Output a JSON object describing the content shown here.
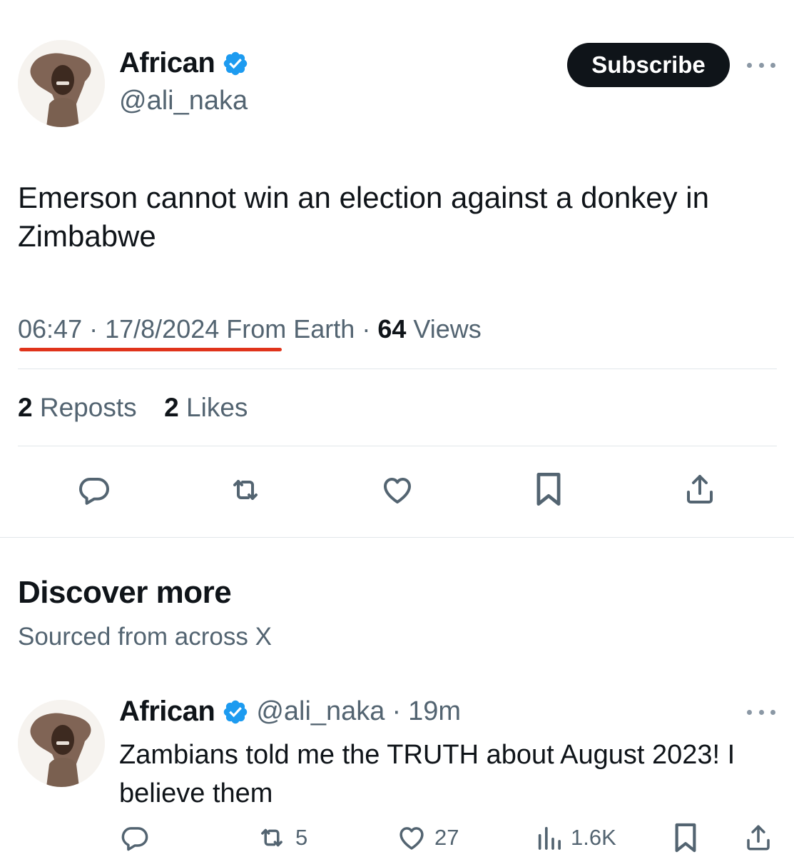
{
  "tweet": {
    "author": {
      "name": "African",
      "handle": "@ali_naka",
      "verified": true
    },
    "subscribe_label": "Subscribe",
    "text": "Emerson cannot win an election against a donkey in Zimbabwe",
    "time": "06:47",
    "date": "17/8/2024",
    "source": "From Earth",
    "views_count": "64",
    "views_label": "Views",
    "reposts_count": "2",
    "reposts_label": "Reposts",
    "likes_count": "2",
    "likes_label": "Likes"
  },
  "discover": {
    "title": "Discover more",
    "subtitle": "Sourced from across X"
  },
  "related_tweet": {
    "author": {
      "name": "African",
      "handle": "@ali_naka",
      "verified": true
    },
    "age": "19m",
    "text": "Zambians told me the TRUTH about August 2023! I believe them",
    "reposts": "5",
    "likes": "27",
    "views": "1.6K"
  },
  "colors": {
    "verified_badge": "#1d9bf0",
    "annotation_underline": "#e0341b",
    "secondary_text": "#536471"
  }
}
